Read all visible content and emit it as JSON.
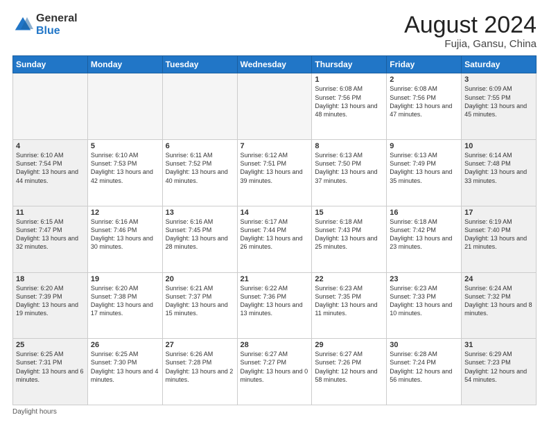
{
  "header": {
    "logo_general": "General",
    "logo_blue": "Blue",
    "title": "August 2024",
    "subtitle": "Fujia, Gansu, China"
  },
  "columns": [
    "Sunday",
    "Monday",
    "Tuesday",
    "Wednesday",
    "Thursday",
    "Friday",
    "Saturday"
  ],
  "weeks": [
    [
      {
        "day": "",
        "info": "",
        "empty": true
      },
      {
        "day": "",
        "info": "",
        "empty": true
      },
      {
        "day": "",
        "info": "",
        "empty": true
      },
      {
        "day": "",
        "info": "",
        "empty": true
      },
      {
        "day": "1",
        "info": "Sunrise: 6:08 AM\nSunset: 7:56 PM\nDaylight: 13 hours and 48 minutes."
      },
      {
        "day": "2",
        "info": "Sunrise: 6:08 AM\nSunset: 7:56 PM\nDaylight: 13 hours and 47 minutes."
      },
      {
        "day": "3",
        "info": "Sunrise: 6:09 AM\nSunset: 7:55 PM\nDaylight: 13 hours and 45 minutes."
      }
    ],
    [
      {
        "day": "4",
        "info": "Sunrise: 6:10 AM\nSunset: 7:54 PM\nDaylight: 13 hours and 44 minutes."
      },
      {
        "day": "5",
        "info": "Sunrise: 6:10 AM\nSunset: 7:53 PM\nDaylight: 13 hours and 42 minutes."
      },
      {
        "day": "6",
        "info": "Sunrise: 6:11 AM\nSunset: 7:52 PM\nDaylight: 13 hours and 40 minutes."
      },
      {
        "day": "7",
        "info": "Sunrise: 6:12 AM\nSunset: 7:51 PM\nDaylight: 13 hours and 39 minutes."
      },
      {
        "day": "8",
        "info": "Sunrise: 6:13 AM\nSunset: 7:50 PM\nDaylight: 13 hours and 37 minutes."
      },
      {
        "day": "9",
        "info": "Sunrise: 6:13 AM\nSunset: 7:49 PM\nDaylight: 13 hours and 35 minutes."
      },
      {
        "day": "10",
        "info": "Sunrise: 6:14 AM\nSunset: 7:48 PM\nDaylight: 13 hours and 33 minutes."
      }
    ],
    [
      {
        "day": "11",
        "info": "Sunrise: 6:15 AM\nSunset: 7:47 PM\nDaylight: 13 hours and 32 minutes."
      },
      {
        "day": "12",
        "info": "Sunrise: 6:16 AM\nSunset: 7:46 PM\nDaylight: 13 hours and 30 minutes."
      },
      {
        "day": "13",
        "info": "Sunrise: 6:16 AM\nSunset: 7:45 PM\nDaylight: 13 hours and 28 minutes."
      },
      {
        "day": "14",
        "info": "Sunrise: 6:17 AM\nSunset: 7:44 PM\nDaylight: 13 hours and 26 minutes."
      },
      {
        "day": "15",
        "info": "Sunrise: 6:18 AM\nSunset: 7:43 PM\nDaylight: 13 hours and 25 minutes."
      },
      {
        "day": "16",
        "info": "Sunrise: 6:18 AM\nSunset: 7:42 PM\nDaylight: 13 hours and 23 minutes."
      },
      {
        "day": "17",
        "info": "Sunrise: 6:19 AM\nSunset: 7:40 PM\nDaylight: 13 hours and 21 minutes."
      }
    ],
    [
      {
        "day": "18",
        "info": "Sunrise: 6:20 AM\nSunset: 7:39 PM\nDaylight: 13 hours and 19 minutes."
      },
      {
        "day": "19",
        "info": "Sunrise: 6:20 AM\nSunset: 7:38 PM\nDaylight: 13 hours and 17 minutes."
      },
      {
        "day": "20",
        "info": "Sunrise: 6:21 AM\nSunset: 7:37 PM\nDaylight: 13 hours and 15 minutes."
      },
      {
        "day": "21",
        "info": "Sunrise: 6:22 AM\nSunset: 7:36 PM\nDaylight: 13 hours and 13 minutes."
      },
      {
        "day": "22",
        "info": "Sunrise: 6:23 AM\nSunset: 7:35 PM\nDaylight: 13 hours and 11 minutes."
      },
      {
        "day": "23",
        "info": "Sunrise: 6:23 AM\nSunset: 7:33 PM\nDaylight: 13 hours and 10 minutes."
      },
      {
        "day": "24",
        "info": "Sunrise: 6:24 AM\nSunset: 7:32 PM\nDaylight: 13 hours and 8 minutes."
      }
    ],
    [
      {
        "day": "25",
        "info": "Sunrise: 6:25 AM\nSunset: 7:31 PM\nDaylight: 13 hours and 6 minutes."
      },
      {
        "day": "26",
        "info": "Sunrise: 6:25 AM\nSunset: 7:30 PM\nDaylight: 13 hours and 4 minutes."
      },
      {
        "day": "27",
        "info": "Sunrise: 6:26 AM\nSunset: 7:28 PM\nDaylight: 13 hours and 2 minutes."
      },
      {
        "day": "28",
        "info": "Sunrise: 6:27 AM\nSunset: 7:27 PM\nDaylight: 13 hours and 0 minutes."
      },
      {
        "day": "29",
        "info": "Sunrise: 6:27 AM\nSunset: 7:26 PM\nDaylight: 12 hours and 58 minutes."
      },
      {
        "day": "30",
        "info": "Sunrise: 6:28 AM\nSunset: 7:24 PM\nDaylight: 12 hours and 56 minutes."
      },
      {
        "day": "31",
        "info": "Sunrise: 6:29 AM\nSunset: 7:23 PM\nDaylight: 12 hours and 54 minutes."
      }
    ]
  ],
  "footer": "Daylight hours"
}
